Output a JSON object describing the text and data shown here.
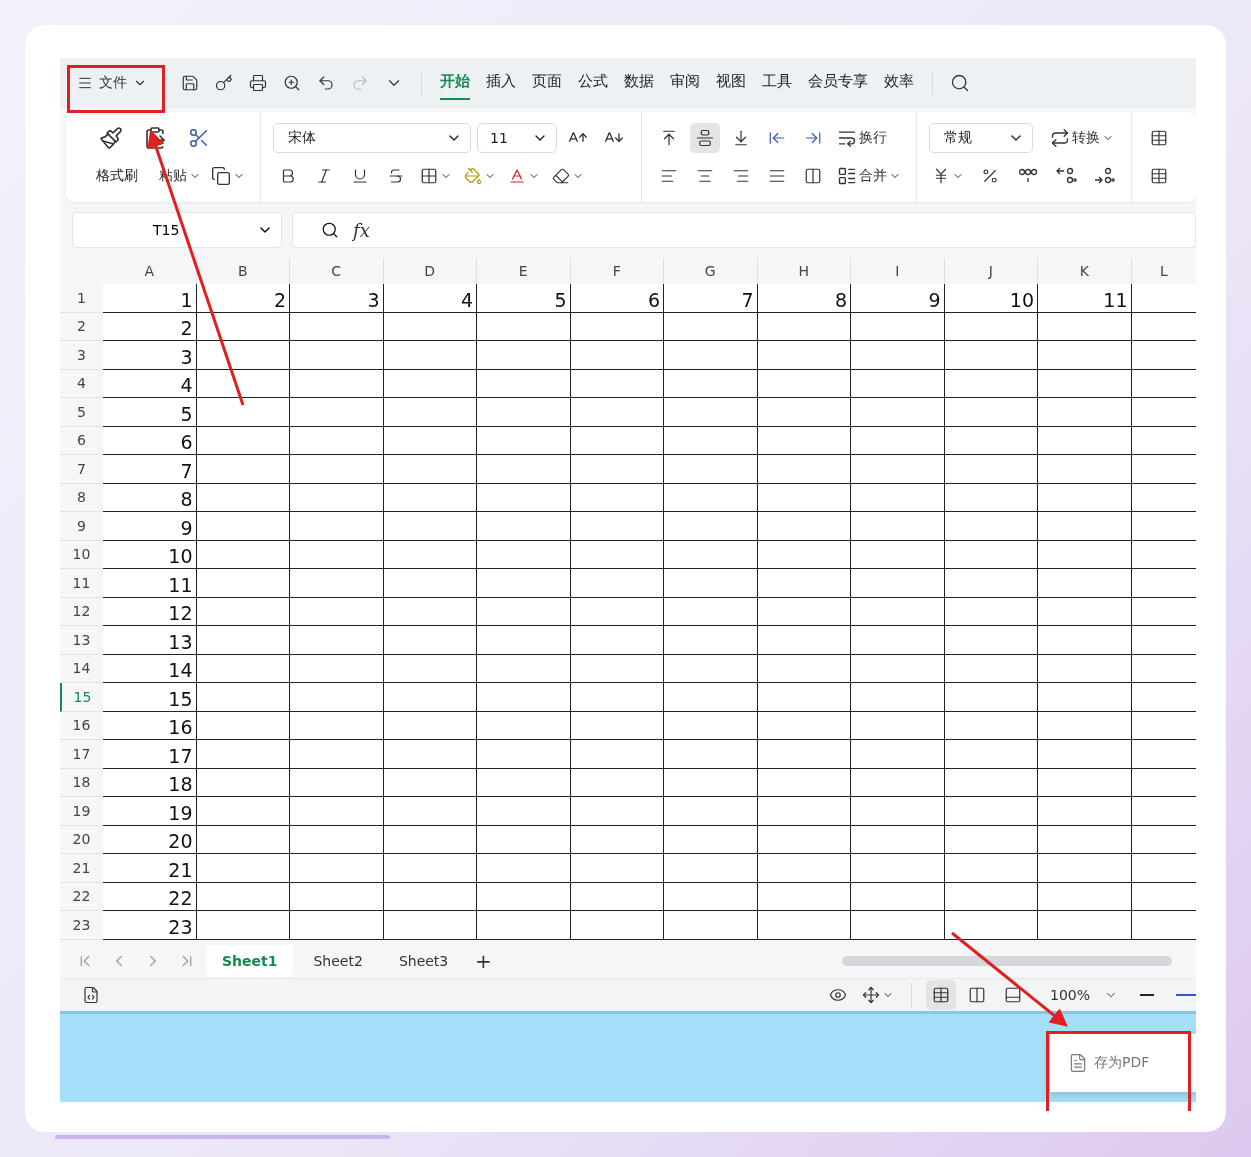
{
  "menu": {
    "file_label": "文件"
  },
  "tabs": [
    {
      "label": "开始",
      "selected": true
    },
    {
      "label": "插入",
      "selected": false
    },
    {
      "label": "页面",
      "selected": false
    },
    {
      "label": "公式",
      "selected": false
    },
    {
      "label": "数据",
      "selected": false
    },
    {
      "label": "审阅",
      "selected": false
    },
    {
      "label": "视图",
      "selected": false
    },
    {
      "label": "工具",
      "selected": false
    },
    {
      "label": "会员专享",
      "selected": false
    },
    {
      "label": "效率",
      "selected": false
    }
  ],
  "ribbon": {
    "format_painter": "格式刷",
    "paste": "粘贴",
    "font_name": "宋体",
    "font_size": "11",
    "wrap": "换行",
    "merge": "合并",
    "number_format": "常规",
    "convert": "转换",
    "align_buttons": [
      {
        "selected": false
      },
      {
        "selected": true
      },
      {
        "selected": false
      }
    ]
  },
  "formula_bar": {
    "name_box": "T15",
    "fx": "fx"
  },
  "grid": {
    "columns": [
      "A",
      "B",
      "C",
      "D",
      "E",
      "F",
      "G",
      "H",
      "I",
      "J",
      "K",
      "L"
    ],
    "rows": [
      {
        "header": "1",
        "selected": false,
        "cells": [
          "1",
          "2",
          "3",
          "4",
          "5",
          "6",
          "7",
          "8",
          "9",
          "10",
          "11"
        ]
      },
      {
        "header": "2",
        "selected": false,
        "cells": [
          "2"
        ]
      },
      {
        "header": "3",
        "selected": false,
        "cells": [
          "3"
        ]
      },
      {
        "header": "4",
        "selected": false,
        "cells": [
          "4"
        ]
      },
      {
        "header": "5",
        "selected": false,
        "cells": [
          "5"
        ]
      },
      {
        "header": "6",
        "selected": false,
        "cells": [
          "6"
        ]
      },
      {
        "header": "7",
        "selected": false,
        "cells": [
          "7"
        ]
      },
      {
        "header": "8",
        "selected": false,
        "cells": [
          "8"
        ]
      },
      {
        "header": "9",
        "selected": false,
        "cells": [
          "9"
        ]
      },
      {
        "header": "10",
        "selected": false,
        "cells": [
          "10"
        ]
      },
      {
        "header": "11",
        "selected": false,
        "cells": [
          "11"
        ]
      },
      {
        "header": "12",
        "selected": false,
        "cells": [
          "12"
        ]
      },
      {
        "header": "13",
        "selected": false,
        "cells": [
          "13"
        ]
      },
      {
        "header": "14",
        "selected": false,
        "cells": [
          "14"
        ]
      },
      {
        "header": "15",
        "selected": true,
        "cells": [
          "15"
        ]
      },
      {
        "header": "16",
        "selected": false,
        "cells": [
          "16"
        ]
      },
      {
        "header": "17",
        "selected": false,
        "cells": [
          "17"
        ]
      },
      {
        "header": "18",
        "selected": false,
        "cells": [
          "18"
        ]
      },
      {
        "header": "19",
        "selected": false,
        "cells": [
          "19"
        ]
      },
      {
        "header": "20",
        "selected": false,
        "cells": [
          "20"
        ]
      },
      {
        "header": "21",
        "selected": false,
        "cells": [
          "21"
        ]
      },
      {
        "header": "22",
        "selected": false,
        "cells": [
          "22"
        ]
      },
      {
        "header": "23",
        "selected": false,
        "cells": [
          "23"
        ]
      }
    ]
  },
  "sheets": [
    {
      "label": "Sheet1",
      "selected": true
    },
    {
      "label": "Sheet2",
      "selected": false
    },
    {
      "label": "Sheet3",
      "selected": false
    }
  ],
  "add_sheet": "+",
  "status_bar": {
    "zoom": "100%",
    "view_modes": [
      {
        "selected": true
      },
      {
        "selected": false
      },
      {
        "selected": false
      }
    ]
  },
  "popup": {
    "save_pdf": "存为PDF"
  }
}
